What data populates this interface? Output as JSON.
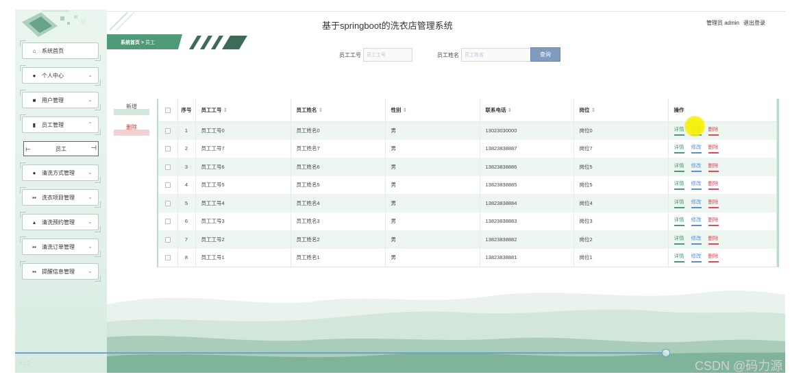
{
  "header": {
    "title": "基于springboot的洗衣店管理系统",
    "user_label": "管理员 admin",
    "logout_label": "退出登录"
  },
  "breadcrumb": {
    "home": "系统首页",
    "separator": ">",
    "current": "员工"
  },
  "sidebar": {
    "items": [
      {
        "label": "系统首页",
        "icon": "home-icon"
      },
      {
        "label": "个人中心",
        "icon": "user-icon"
      },
      {
        "label": "用户管理",
        "icon": "folder-icon"
      },
      {
        "label": "员工管理",
        "icon": "badge-icon"
      },
      {
        "label": "清洗方式管理",
        "icon": "user-icon"
      },
      {
        "label": "洗衣项目管理",
        "icon": "grid-icon"
      },
      {
        "label": "清洗预约管理",
        "icon": "thumb-icon"
      },
      {
        "label": "清洗订单管理",
        "icon": "grid-icon"
      },
      {
        "label": "提醒信息管理",
        "icon": "grid-icon"
      }
    ],
    "sub_item": "员工"
  },
  "search": {
    "field1_label": "员工工号",
    "field1_placeholder": "员工工号",
    "field2_label": "员工姓名",
    "field2_placeholder": "员工姓名",
    "query_button": "查询"
  },
  "actions": {
    "add": "新增",
    "delete": "删除"
  },
  "table": {
    "headers": {
      "index": "序号",
      "emp_no": "员工工号",
      "emp_name": "员工姓名",
      "gender": "性别",
      "phone": "联系电话",
      "position": "岗位",
      "ops": "操作"
    },
    "op_labels": {
      "detail": "详情",
      "edit": "修改",
      "remove": "删除"
    },
    "rows": [
      {
        "idx": "1",
        "emp_no": "员工工号0",
        "emp_name": "员工姓名0",
        "gender": "男",
        "phone": "13023030000",
        "position": "岗位0"
      },
      {
        "idx": "2",
        "emp_no": "员工工号7",
        "emp_name": "员工姓名7",
        "gender": "男",
        "phone": "13823838887",
        "position": "岗位7"
      },
      {
        "idx": "3",
        "emp_no": "员工工号6",
        "emp_name": "员工姓名6",
        "gender": "男",
        "phone": "13823838886",
        "position": "岗位5"
      },
      {
        "idx": "4",
        "emp_no": "员工工号5",
        "emp_name": "员工姓名5",
        "gender": "男",
        "phone": "13823838885",
        "position": "岗位5"
      },
      {
        "idx": "5",
        "emp_no": "员工工号4",
        "emp_name": "员工姓名4",
        "gender": "男",
        "phone": "13823838884",
        "position": "岗位4"
      },
      {
        "idx": "6",
        "emp_no": "员工工号3",
        "emp_name": "员工姓名3",
        "gender": "男",
        "phone": "13823838883",
        "position": "岗位3"
      },
      {
        "idx": "7",
        "emp_no": "员工工号2",
        "emp_name": "员工姓名2",
        "gender": "男",
        "phone": "13823838882",
        "position": "岗位2"
      },
      {
        "idx": "8",
        "emp_no": "员工工号1",
        "emp_name": "员工姓名1",
        "gender": "男",
        "phone": "13823838881",
        "position": "岗位1"
      }
    ]
  },
  "video": {
    "time": "0:12"
  },
  "watermark": "CSDN @码力源",
  "colors": {
    "accent_green": "#4a9a73",
    "query_button": "#7f9bbf",
    "delete_red": "#d94a5a",
    "edit_blue": "#5b8fd0"
  }
}
